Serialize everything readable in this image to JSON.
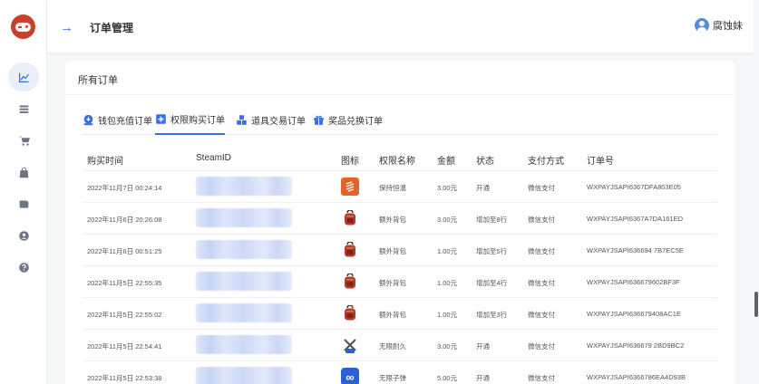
{
  "header": {
    "back_icon": "arrow-right-icon",
    "title": "订单管理",
    "user_name": "腐蚀妹"
  },
  "sidebar": {
    "items": [
      {
        "icon": "chart-icon",
        "active": true
      },
      {
        "icon": "list-icon",
        "active": false
      },
      {
        "icon": "cart-icon",
        "active": false
      },
      {
        "icon": "bag-icon",
        "active": false
      },
      {
        "icon": "wallet-icon",
        "active": false
      },
      {
        "icon": "user-circle-icon",
        "active": false
      },
      {
        "icon": "help-icon",
        "active": false
      }
    ]
  },
  "card": {
    "title": "所有订单",
    "tabs": [
      {
        "label": "钱包充值订单",
        "icon": "wallet-download-icon",
        "active": false
      },
      {
        "label": "权限购买订单",
        "icon": "plus-square-icon",
        "active": true
      },
      {
        "label": "道具交易订单",
        "icon": "cubes-icon",
        "active": false
      },
      {
        "label": "奖品兑换订单",
        "icon": "gift-icon",
        "active": false
      }
    ],
    "columns": [
      "购买时间",
      "SteamID",
      "图标",
      "权限名称",
      "金额",
      "状态",
      "支付方式",
      "订单号"
    ],
    "rows": [
      {
        "time": "2022年11月7日 00:24:14",
        "icon": "stack-icon",
        "name": "保持恒温",
        "amount": "3.00元",
        "status": "开通",
        "pay": "微信支付",
        "order": "WXPAYJSAPI6367DFA803E05"
      },
      {
        "time": "2022年11月6日 20:26:08",
        "icon": "backpack-icon",
        "name": "额外背包",
        "amount": "3.00元",
        "status": "增加至8行",
        "pay": "微信支付",
        "order": "WXPAYJSAPI6367A7DA161ED"
      },
      {
        "time": "2022年11月6日 00:51:25",
        "icon": "backpack-icon",
        "name": "额外背包",
        "amount": "1.00元",
        "status": "增加至5行",
        "pay": "微信支付",
        "order": "WXPAYJSAPI636694 7B7EC5E"
      },
      {
        "time": "2022年11月5日 22:55:35",
        "icon": "backpack-icon",
        "name": "额外背包",
        "amount": "1.00元",
        "status": "增加至4行",
        "pay": "微信支付",
        "order": "WXPAYJSAPI636679602BF3F"
      },
      {
        "time": "2022年11月5日 22:55:02",
        "icon": "backpack-icon",
        "name": "额外背包",
        "amount": "1.00元",
        "status": "增加至3行",
        "pay": "微信支付",
        "order": "WXPAYJSAPI636679408AC1E"
      },
      {
        "time": "2022年11月5日 22:54:41",
        "icon": "tools-icon",
        "name": "无限耐久",
        "amount": "3.00元",
        "status": "开通",
        "pay": "微信支付",
        "order": "WXPAYJSAPI636679 2BD9BC2"
      },
      {
        "time": "2022年11月5日 22:53:38",
        "icon": "infinity-icon",
        "name": "无限子弹",
        "amount": "5.00元",
        "status": "开通",
        "pay": "微信支付",
        "order": "WXPAYJSAPI6366786EA4D93B"
      }
    ]
  },
  "colors": {
    "accent": "#3a6fe0",
    "logo": "#c8412b",
    "backpack": "#b33a2a",
    "stack": "#e0642c",
    "infinity": "#2f5fd6"
  }
}
